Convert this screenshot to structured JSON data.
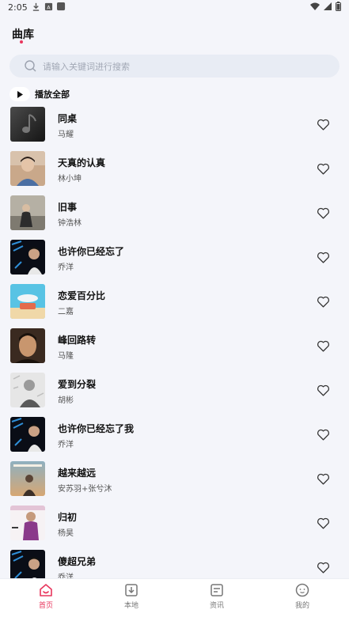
{
  "status_bar": {
    "time": "2:05"
  },
  "header": {
    "title": "曲库"
  },
  "search": {
    "placeholder": "请输入关键词进行搜索"
  },
  "play_all": {
    "label": "播放全部"
  },
  "songs": [
    {
      "title": "同桌",
      "artist": "马耀"
    },
    {
      "title": "天真的认真",
      "artist": "林小坤"
    },
    {
      "title": "旧事",
      "artist": "钟浩林"
    },
    {
      "title": "也许你已经忘了",
      "artist": "乔洋"
    },
    {
      "title": "恋爱百分比",
      "artist": "二嘉"
    },
    {
      "title": "峰回路转",
      "artist": "马隆"
    },
    {
      "title": "爱到分裂",
      "artist": "胡彬"
    },
    {
      "title": "也许你已经忘了我",
      "artist": "乔洋"
    },
    {
      "title": "越来越远",
      "artist": "安苏羽+张兮沐"
    },
    {
      "title": "归初",
      "artist": "杨昊"
    },
    {
      "title": "傻超兄弟",
      "artist": "乔洋"
    }
  ],
  "bottom_nav": [
    {
      "label": "首页",
      "icon": "home-icon",
      "active": true
    },
    {
      "label": "本地",
      "icon": "download-icon",
      "active": false
    },
    {
      "label": "资讯",
      "icon": "news-icon",
      "active": false
    },
    {
      "label": "我的",
      "icon": "profile-icon",
      "active": false
    }
  ],
  "colors": {
    "accent": "#e8365d",
    "background": "#f4f5fa",
    "search_bg": "#e8ecf4"
  }
}
